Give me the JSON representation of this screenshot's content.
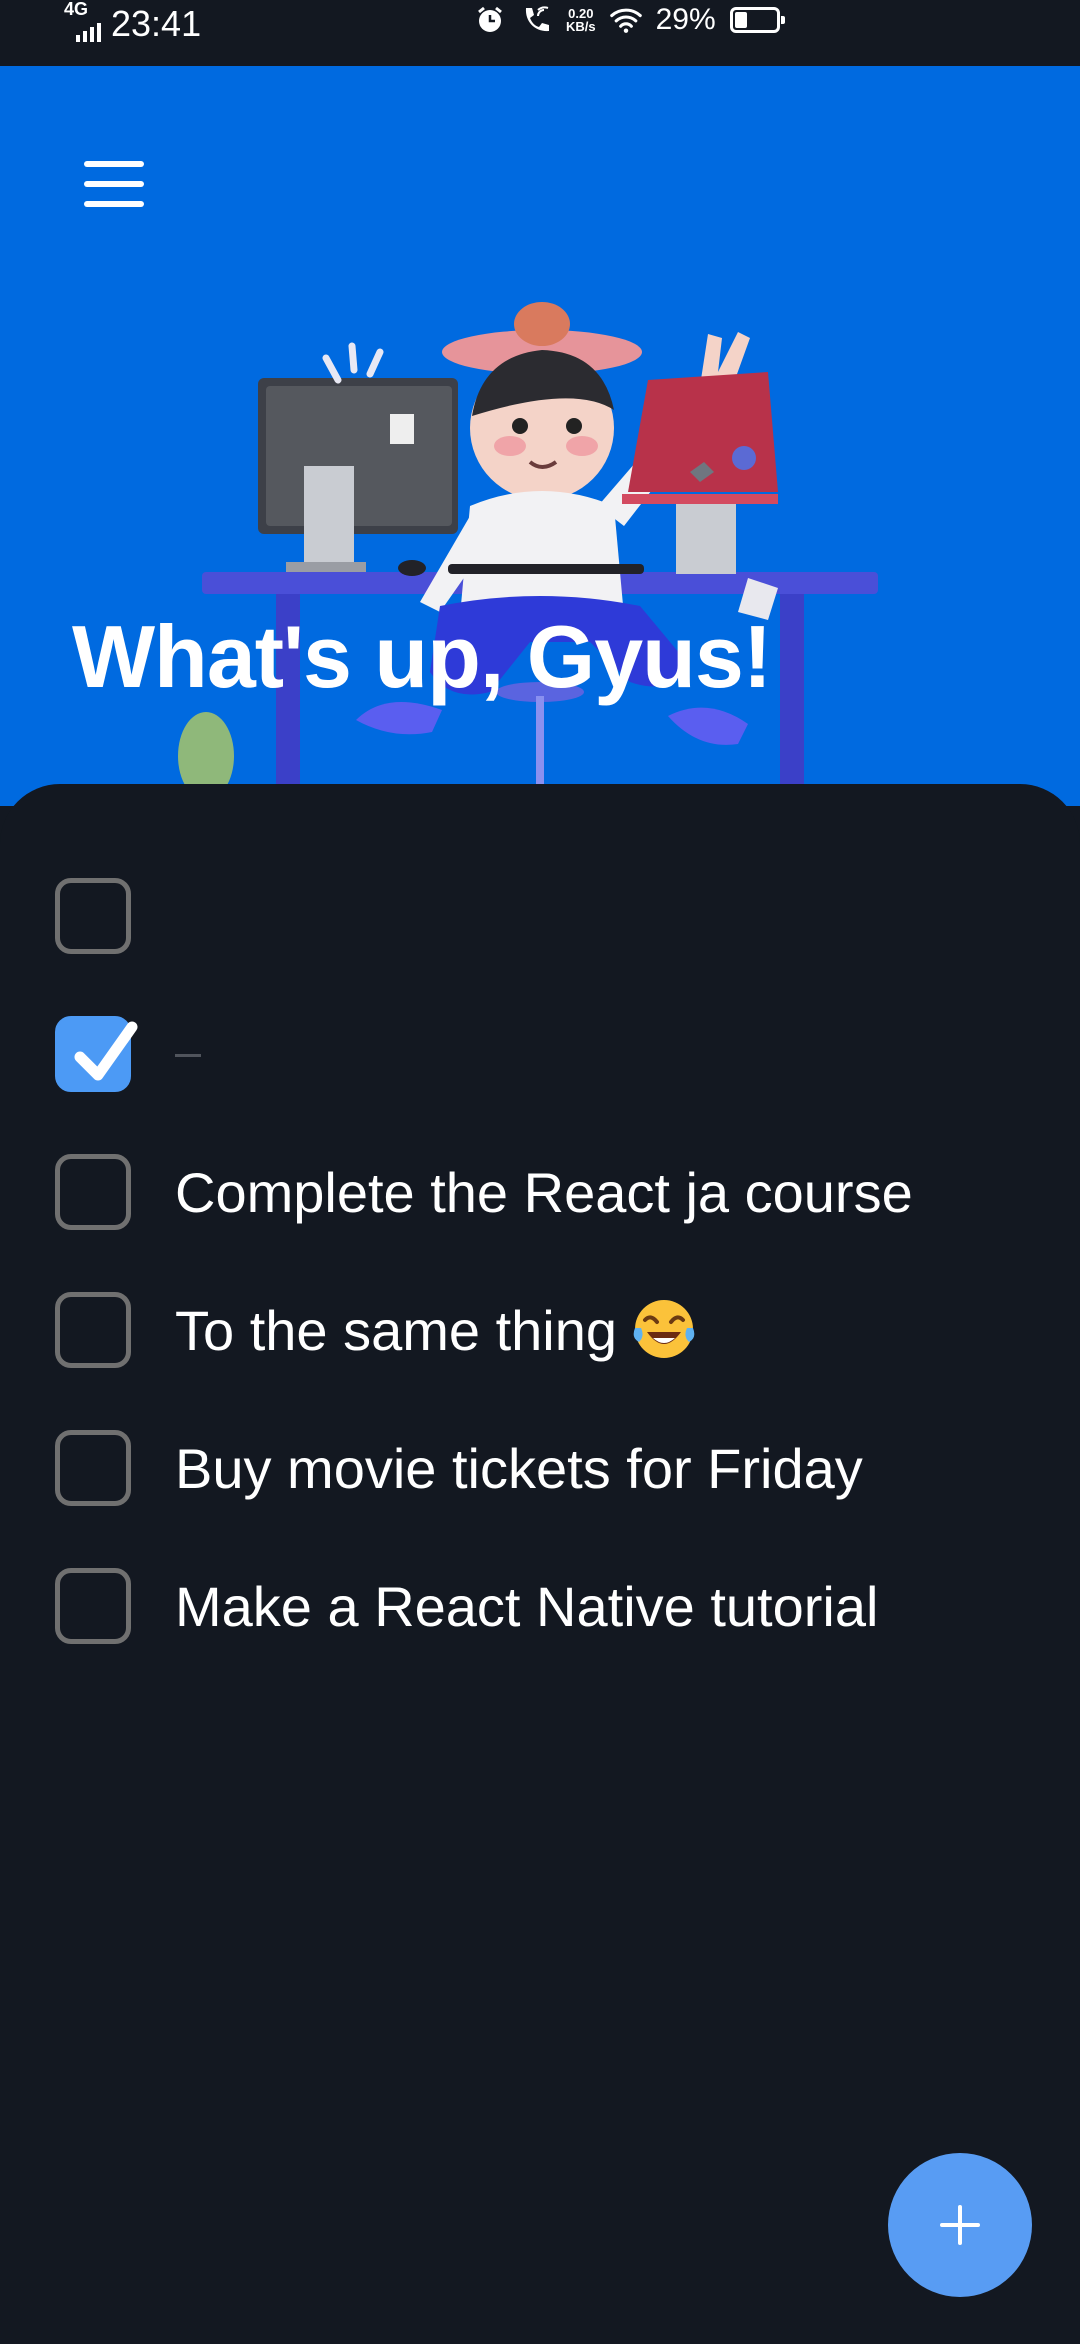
{
  "status_bar": {
    "network": "4G",
    "time": "23:41",
    "speed_value": "0.20",
    "speed_unit": "KB/s",
    "battery_percent": "29%",
    "battery_level": 0.29,
    "icons": [
      "alarm-icon",
      "wifi-call-icon",
      "wifi-icon",
      "battery-icon"
    ]
  },
  "header": {
    "menu_icon": "hamburger-menu-icon",
    "title": "What's up, Gyus!",
    "background_color": "#006ae0"
  },
  "tasks": [
    {
      "label": "",
      "checked": false
    },
    {
      "label": "",
      "checked": true
    },
    {
      "label": "Complete the React ja course",
      "checked": false
    },
    {
      "label": "To the same thing",
      "emoji": "face-with-tears-of-joy",
      "checked": false
    },
    {
      "label": "Buy movie tickets for Friday",
      "checked": false
    },
    {
      "label": "Make a React Native tutorial",
      "checked": false
    }
  ],
  "fab": {
    "icon": "plus-icon",
    "color": "#589cf3"
  },
  "colors": {
    "accent": "#4c9af5",
    "background": "#131821"
  }
}
